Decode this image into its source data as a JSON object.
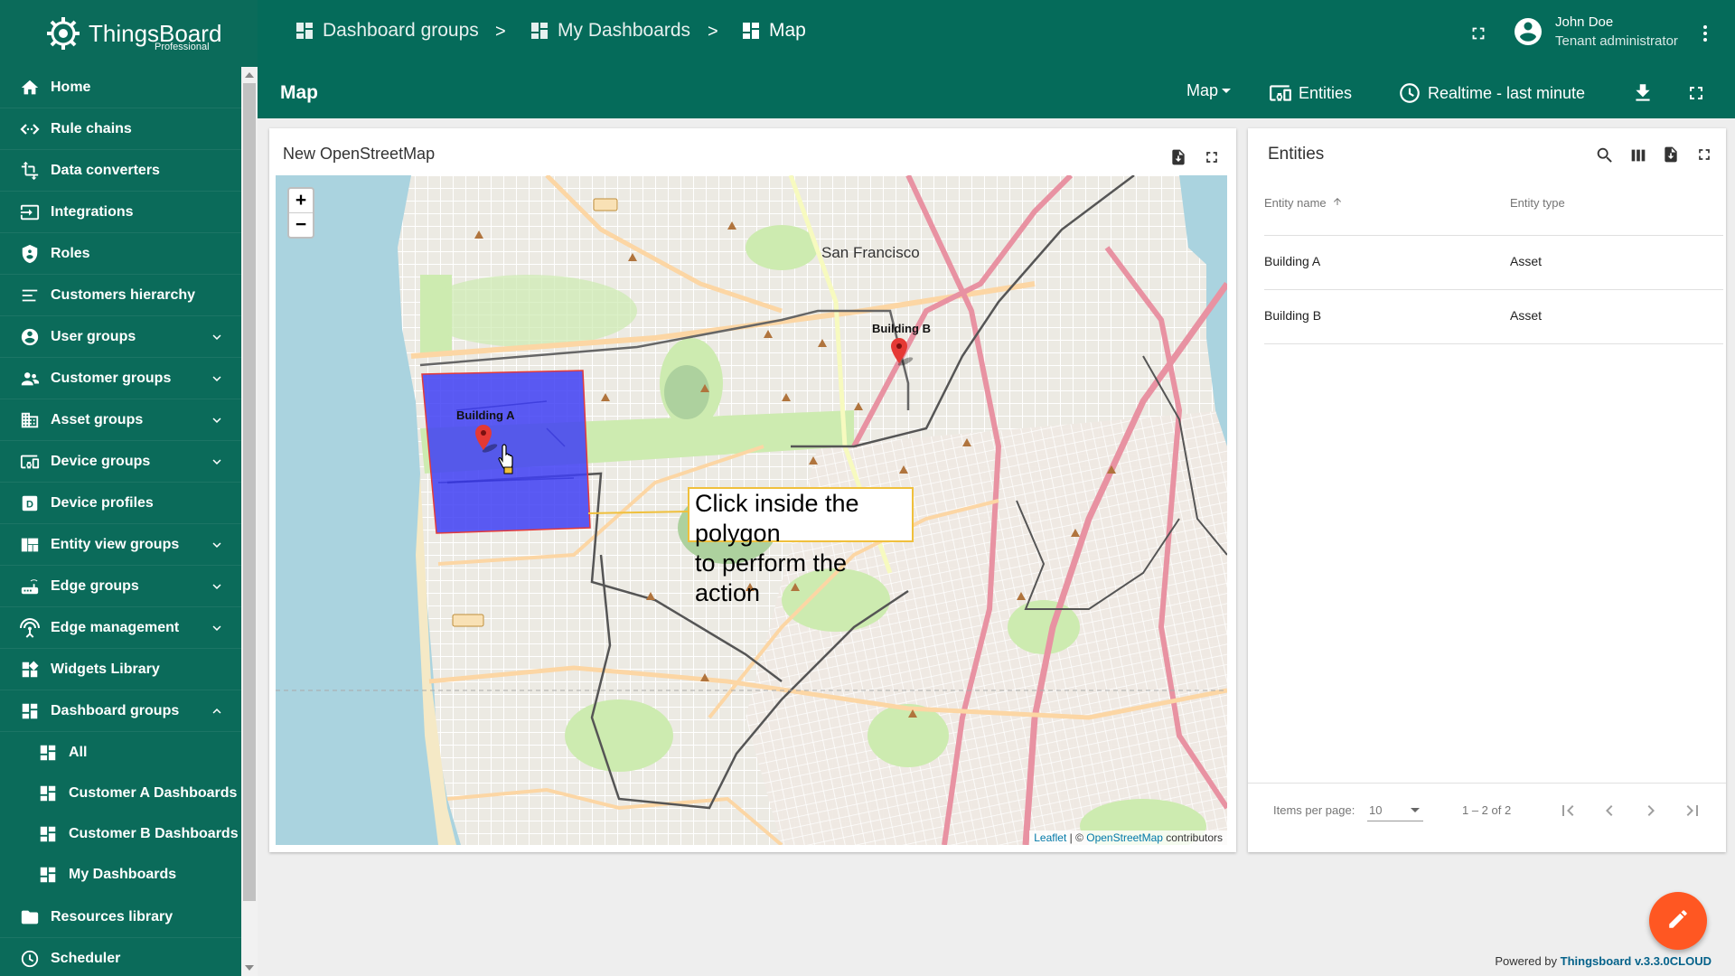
{
  "brand": {
    "name": "ThingsBoard",
    "edition": "Professional"
  },
  "breadcrumbs": [
    {
      "label": "Dashboard groups"
    },
    {
      "label": "My Dashboards"
    },
    {
      "label": "Map"
    }
  ],
  "breadcrumb_separator": ">",
  "user": {
    "name": "John Doe",
    "role": "Tenant administrator"
  },
  "toolbar": {
    "title": "Map",
    "state_select": "Map",
    "entities_label": "Entities",
    "timewindow_label": "Realtime - last minute"
  },
  "sidebar": {
    "items": [
      {
        "label": "Home",
        "icon": "home-icon"
      },
      {
        "label": "Rule chains",
        "icon": "code-arrows-icon"
      },
      {
        "label": "Data converters",
        "icon": "transform-icon"
      },
      {
        "label": "Integrations",
        "icon": "input-icon"
      },
      {
        "label": "Roles",
        "icon": "shield-icon"
      },
      {
        "label": "Customers hierarchy",
        "icon": "hierarchy-icon"
      },
      {
        "label": "User groups",
        "icon": "account-icon",
        "expandable": true
      },
      {
        "label": "Customer groups",
        "icon": "supervisor-icon",
        "expandable": true
      },
      {
        "label": "Asset groups",
        "icon": "domain-icon",
        "expandable": true
      },
      {
        "label": "Device groups",
        "icon": "devices-other-icon",
        "expandable": true
      },
      {
        "label": "Device profiles",
        "icon": "device-profile-icon"
      },
      {
        "label": "Entity view groups",
        "icon": "view-quilt-icon",
        "expandable": true
      },
      {
        "label": "Edge groups",
        "icon": "router-icon",
        "expandable": true
      },
      {
        "label": "Edge management",
        "icon": "settings-input-antenna-icon",
        "expandable": true
      },
      {
        "label": "Widgets Library",
        "icon": "widgets-icon"
      },
      {
        "label": "Dashboard groups",
        "icon": "dashboard-icon",
        "expanded": true
      }
    ],
    "dashboard_subitems": [
      {
        "label": "All"
      },
      {
        "label": "Customer A Dashboards"
      },
      {
        "label": "Customer B Dashboards"
      },
      {
        "label": "My Dashboards"
      }
    ],
    "bottom_items": [
      {
        "label": "Resources library",
        "icon": "folder-icon"
      },
      {
        "label": "Scheduler",
        "icon": "schedule-icon"
      }
    ]
  },
  "map_widget": {
    "title": "New OpenStreetMap",
    "zoom_in": "+",
    "zoom_out": "−",
    "markers": [
      {
        "label": "Building A"
      },
      {
        "label": "Building B"
      }
    ],
    "tooltip_line1": "Click inside the polygon",
    "tooltip_line2": "to perform the action",
    "city_label": "San Francisco",
    "attribution": {
      "leaflet": "Leaflet",
      "sep": " | © ",
      "osm": "OpenStreetMap",
      "suffix": " contributors"
    },
    "polygon_color": "#3f3ff5"
  },
  "entities_widget": {
    "title": "Entities",
    "columns": [
      "Entity name",
      "Entity type"
    ],
    "rows": [
      {
        "name": "Building A",
        "type": "Asset"
      },
      {
        "name": "Building B",
        "type": "Asset"
      }
    ],
    "pager": {
      "items_per_page_label": "Items per page:",
      "page_size": "10",
      "range": "1 – 2 of 2"
    }
  },
  "footer": {
    "powered_prefix": "Powered by ",
    "powered_link": "Thingsboard v.3.3.0CLOUD"
  },
  "colors": {
    "primary": "#056b5a",
    "fab": "#ff5722"
  }
}
